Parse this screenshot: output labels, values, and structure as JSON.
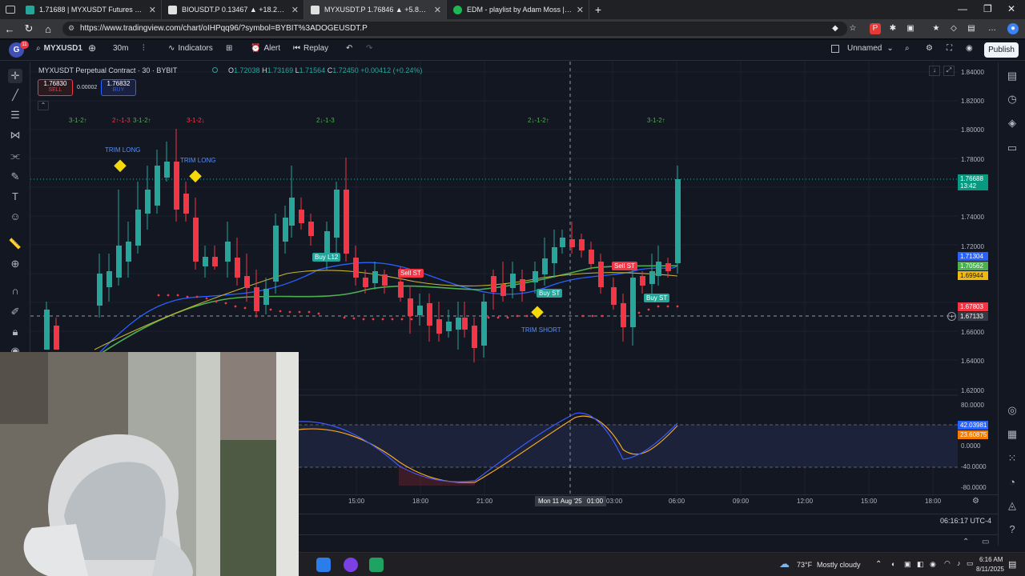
{
  "browser": {
    "tabs": [
      {
        "title": "1.71688 | MYXUSDT Futures Exch",
        "favicon_color": "#26a69a"
      },
      {
        "title": "BIOUSDT.P 0.13467 ▲ +18.24% U",
        "favicon_color": "#e0e0e0"
      },
      {
        "title": "MYXUSDT.P 1.76846 ▲ +5.89% U",
        "favicon_color": "#e0e0e0"
      },
      {
        "title": "EDM - playlist by Adam Moss | Sp",
        "favicon_color": "#1db954"
      }
    ],
    "new_tab": "+",
    "url": "https://www.tradingview.com/chart/oIHPqq96/?symbol=BYBIT%3ADOGEUSDT.P"
  },
  "toolbar": {
    "avatar_letter": "G",
    "avatar_badge": "11",
    "symbol": "MYXUSD1",
    "timeframe": "30m",
    "indicators": "Indicators",
    "alert": "Alert",
    "replay": "Replay",
    "layout_name": "Unnamed",
    "publish": "Publish"
  },
  "chart": {
    "title": "MYXUSDT Perpetual Contract · 30 · BYBIT",
    "ohlc": {
      "o_label": "O",
      "o": "1.72038",
      "h_label": "H",
      "h": "1.73169",
      "l_label": "L",
      "l": "1.71564",
      "c_label": "C",
      "c": "1.72450",
      "change": "+0.00412 (+0.24%)"
    },
    "sell_price": "1.76830",
    "sell_label": "SELL",
    "spread": "0.00002",
    "buy_price": "1.76832",
    "buy_label": "BUY",
    "annotations": {
      "trim_long_1": "TRIM LONG",
      "trim_long_2": "TRIM LONG",
      "trim_short": "TRIM SHORT",
      "buy_l12": "Buy L12",
      "sell_st_1": "Sell ST",
      "sell_st_2": "Sell ST",
      "buy_st_1": "Buy ST",
      "buy_st_2": "Buy ST",
      "pattern_1": "3-1-2↑",
      "pattern_2": "2↑-1-3",
      "pattern_3": "3-1-2↑",
      "pattern_4": "3-1-2↓",
      "pattern_5": "2↓-1-3",
      "pattern_6": "2↓-1-2↑",
      "pattern_7": "3-1-2↑"
    },
    "price_ticks": [
      "1.84000",
      "1.82000",
      "1.80000",
      "1.78000",
      "1.74000",
      "1.72000",
      "1.66000",
      "1.64000",
      "1.62000"
    ],
    "price_badges": [
      {
        "value": "1.76688",
        "sub": "13:42",
        "color": "#089981"
      },
      {
        "value": "1.71304",
        "color": "#2962ff"
      },
      {
        "value": "1.70562",
        "color": "#4caf50"
      },
      {
        "value": "1.69944",
        "color": "#f0b90b"
      },
      {
        "value": "1.67803",
        "color": "#f23645"
      },
      {
        "value": "1.67133",
        "color": "#363a45"
      }
    ],
    "osc_ticks": [
      "80.0000",
      "0.0000",
      "-40.0000",
      "-80.0000"
    ],
    "osc_badges": [
      {
        "value": "42.03981",
        "color": "#2962ff"
      },
      {
        "value": "23.60875",
        "color": "#f57c00"
      }
    ],
    "time_ticks": [
      "15:00",
      "18:00",
      "21:00",
      "03:00",
      "06:00",
      "09:00",
      "12:00",
      "15:00",
      "18:00"
    ],
    "crosshair_time": "Mon 11 Aug '25",
    "crosshair_time_2": "01:00",
    "clock": "06:16:17 UTC-4"
  },
  "taskbar": {
    "weather_temp": "73°F",
    "weather_text": "Mostly cloudy",
    "time": "6:16 AM",
    "date": "8/11/2025"
  }
}
